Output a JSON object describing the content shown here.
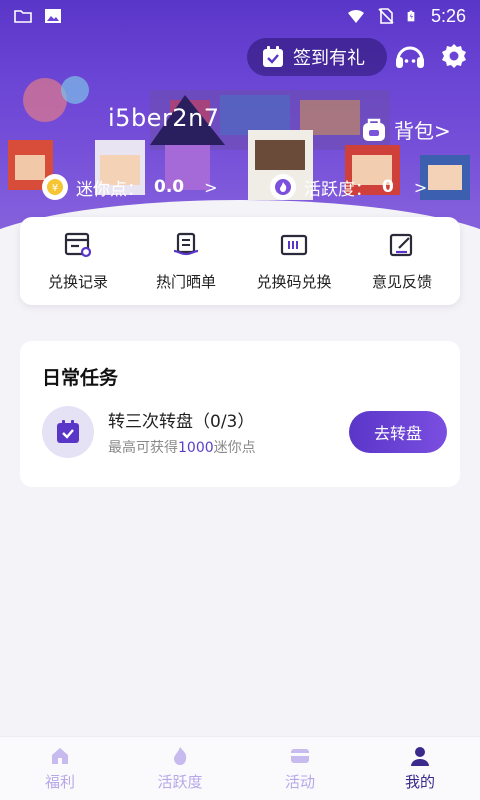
{
  "status_bar": {
    "time": "5:26"
  },
  "header": {
    "checkin_label": "签到有礼",
    "username": "i5ber2n7",
    "backpack_label": "背包>",
    "mini_points_label": "迷你点：",
    "mini_points_value": "0.0",
    "activity_label": "活跃度：",
    "activity_value": "0"
  },
  "quick_actions": [
    {
      "label": "兑换记录",
      "icon": "exchange-record-icon"
    },
    {
      "label": "热门晒单",
      "icon": "hot-share-icon"
    },
    {
      "label": "兑换码兑换",
      "icon": "redeem-code-icon"
    },
    {
      "label": "意见反馈",
      "icon": "feedback-icon"
    }
  ],
  "daily_tasks": {
    "title": "日常任务",
    "task_name": "转三次转盘（0/3）",
    "desc_prefix": "最高可获得",
    "desc_highlight": "1000",
    "desc_suffix": "迷你点",
    "button_label": "去转盘"
  },
  "bottom_nav": [
    {
      "label": "福利",
      "icon": "home-icon",
      "active": false
    },
    {
      "label": "活跃度",
      "icon": "flame-icon",
      "active": false
    },
    {
      "label": "活动",
      "icon": "card-icon",
      "active": false
    },
    {
      "label": "我的",
      "icon": "user-icon",
      "active": true
    }
  ],
  "colors": {
    "primary": "#5a36c8",
    "accent_text": "#5b3fcc",
    "nav_active": "#3b2a8c",
    "nav_inactive": "#b7a8e8"
  }
}
